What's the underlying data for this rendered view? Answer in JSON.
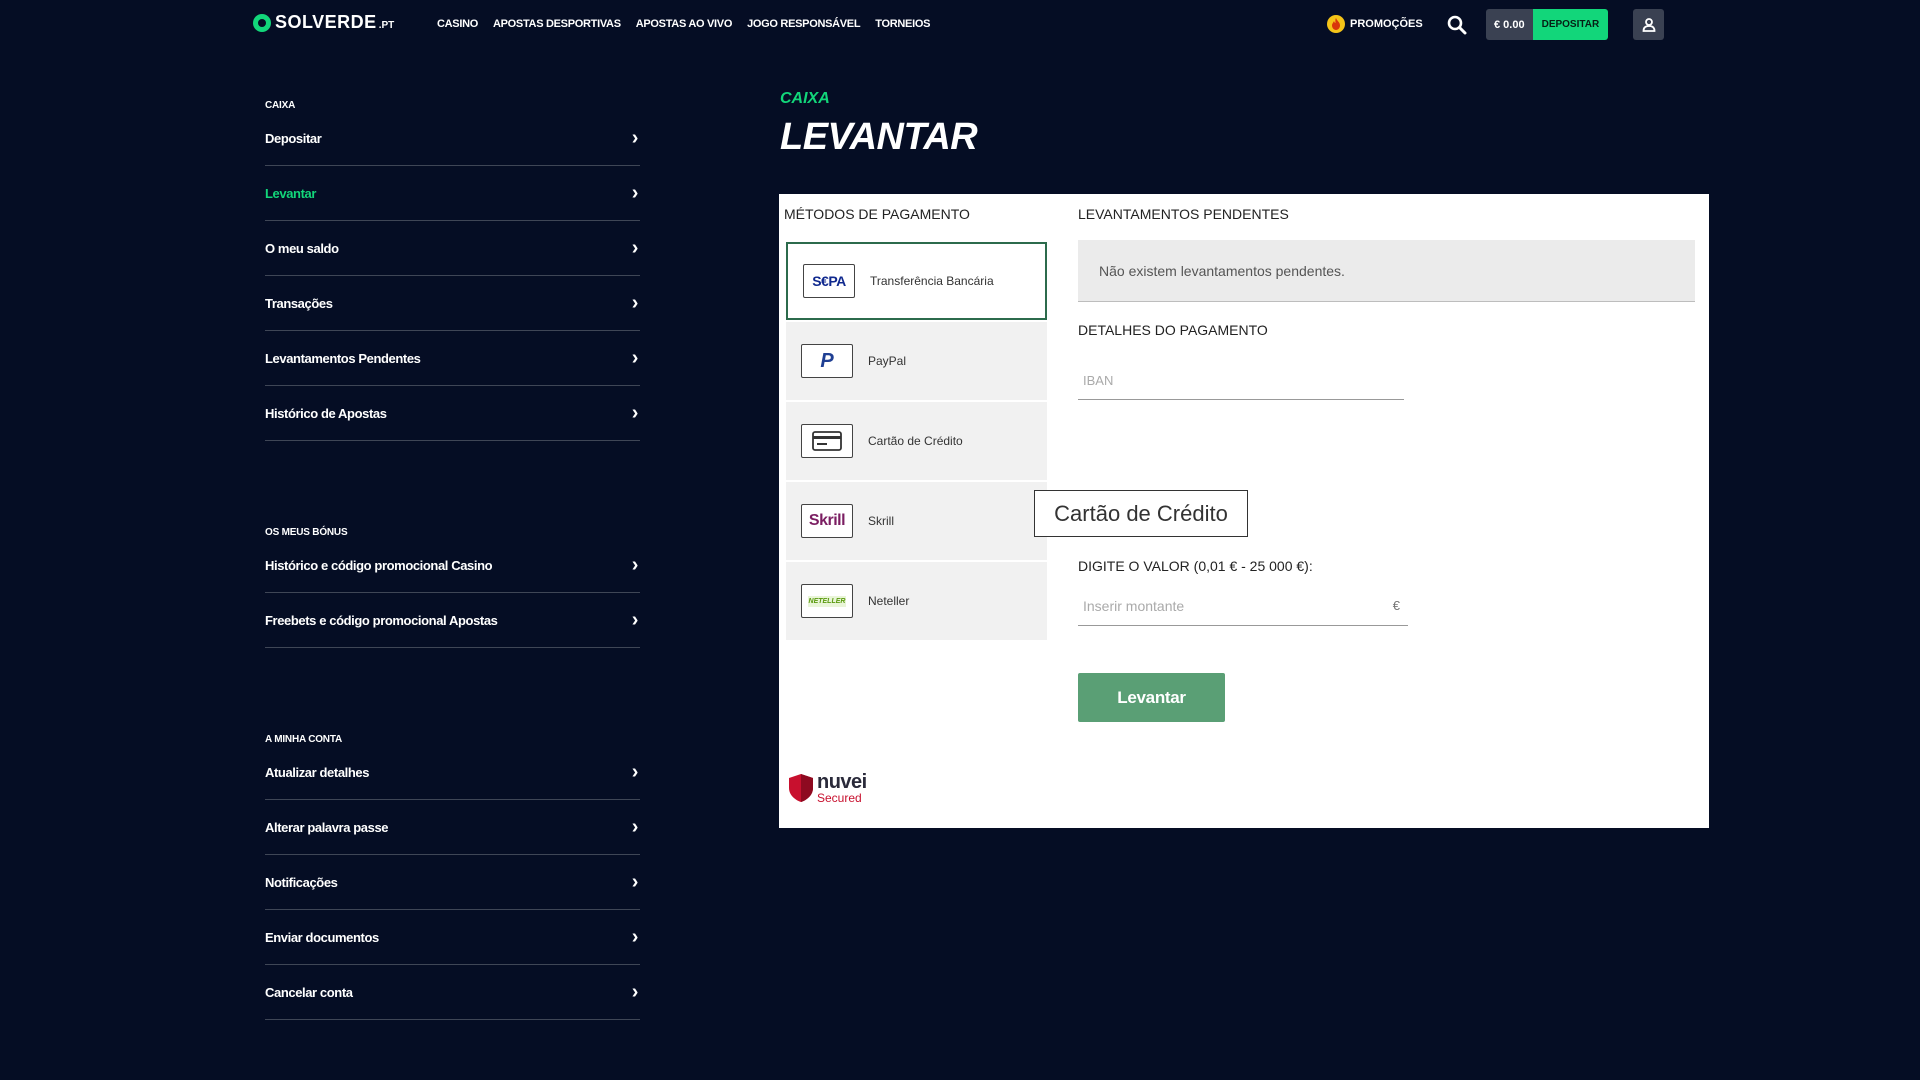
{
  "header": {
    "logo_text": "SOLVERDE",
    "logo_suffix": ".PT",
    "nav": [
      "CASINO",
      "APOSTAS DESPORTIVAS",
      "APOSTAS AO VIVO",
      "JOGO RESPONSÁVEL",
      "TORNEIOS"
    ],
    "promotions_label": "PROMOÇÕES",
    "balance": "€ 0.00",
    "deposit_label": "DEPOSITAR"
  },
  "sidebar": {
    "caixa": {
      "title": "CAIXA",
      "items": [
        {
          "label": "Depositar"
        },
        {
          "label": "Levantar"
        },
        {
          "label": "O meu saldo"
        },
        {
          "label": "Transações"
        },
        {
          "label": "Levantamentos Pendentes"
        },
        {
          "label": "Histórico de Apostas"
        }
      ]
    },
    "bonus": {
      "title": "OS MEUS BÓNUS",
      "items": [
        {
          "label": "Histórico e código promocional Casino"
        },
        {
          "label": "Freebets e código promocional Apostas"
        }
      ]
    },
    "account": {
      "title": "A MINHA CONTA",
      "items": [
        {
          "label": "Atualizar detalhes"
        },
        {
          "label": "Alterar palavra passe"
        },
        {
          "label": "Notificações"
        },
        {
          "label": "Enviar documentos"
        },
        {
          "label": "Cancelar conta"
        }
      ]
    },
    "active_item": "Levantar",
    "chevron": "›"
  },
  "main": {
    "breadcrumb": "CAIXA",
    "title": "LEVANTAR",
    "methods_title": "MÉTODOS DE PAGAMENTO",
    "methods": [
      {
        "label": "Transferência Bancária",
        "logo": "S€PA",
        "icon": "sepa-logo",
        "selected": true
      },
      {
        "label": "PayPal",
        "logo": "P",
        "icon": "paypal-logo"
      },
      {
        "label": "Cartão de Crédito",
        "logo": "",
        "icon": "credit-card-icon"
      },
      {
        "label": "Skrill",
        "logo": "Skrill",
        "icon": "skrill-logo"
      },
      {
        "label": "Neteller",
        "logo": "NETELLER",
        "icon": "neteller-logo"
      }
    ],
    "pending_title": "LEVANTAMENTOS PENDENTES",
    "pending_message": "Não existem levantamentos pendentes.",
    "details_title": "DETALHES DO PAGAMENTO",
    "iban_placeholder": "IBAN",
    "amount_title": "DIGITE O VALOR (0,01 € - 25 000 €):",
    "amount_placeholder": "Inserir montante",
    "currency": "€",
    "withdraw_label": "Levantar",
    "secured_brand": "nuvei",
    "secured_label": "Secured"
  },
  "tooltip": "Cartão de Crédito",
  "colors": {
    "background": "#050d24",
    "accent": "#12d67a",
    "button": "#5a9f75",
    "secured_red": "#c8102e"
  }
}
